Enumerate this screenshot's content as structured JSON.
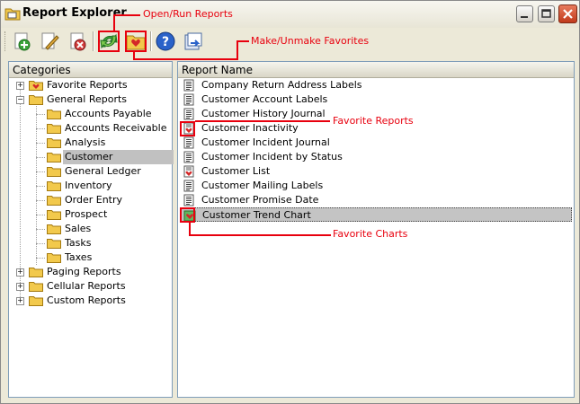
{
  "window": {
    "title": "Report Explorer"
  },
  "toolbar": {
    "buttons": [
      "new-report-icon",
      "edit-report-icon",
      "delete-report-icon",
      "open-run-report-icon",
      "make-favorite-icon",
      "help-icon",
      "export-icon"
    ]
  },
  "categories_panel": {
    "header": "Categories",
    "items": [
      {
        "label": "Favorite Reports",
        "level": 0,
        "expander": "+",
        "favorite": true
      },
      {
        "label": "General Reports",
        "level": 0,
        "expander": "−"
      },
      {
        "label": "Accounts Payable",
        "level": 1
      },
      {
        "label": "Accounts Receivable",
        "level": 1
      },
      {
        "label": "Analysis",
        "level": 1
      },
      {
        "label": "Customer",
        "level": 1,
        "selected": true
      },
      {
        "label": "General Ledger",
        "level": 1
      },
      {
        "label": "Inventory",
        "level": 1
      },
      {
        "label": "Order Entry",
        "level": 1
      },
      {
        "label": "Prospect",
        "level": 1
      },
      {
        "label": "Sales",
        "level": 1
      },
      {
        "label": "Tasks",
        "level": 1
      },
      {
        "label": "Taxes",
        "level": 1
      },
      {
        "label": "Paging Reports",
        "level": 0,
        "expander": "+"
      },
      {
        "label": "Cellular Reports",
        "level": 0,
        "expander": "+"
      },
      {
        "label": "Custom Reports",
        "level": 0,
        "expander": "+"
      }
    ]
  },
  "reports_panel": {
    "header": "Report Name",
    "items": [
      {
        "label": "Company Return Address Labels",
        "icon": "report"
      },
      {
        "label": "Customer Account Labels",
        "icon": "report"
      },
      {
        "label": "Customer History Journal",
        "icon": "report"
      },
      {
        "label": "Customer Inactivity",
        "icon": "favorite-report"
      },
      {
        "label": "Customer Incident Journal",
        "icon": "report"
      },
      {
        "label": "Customer Incident by Status",
        "icon": "report"
      },
      {
        "label": "Customer List",
        "icon": "favorite-report"
      },
      {
        "label": "Customer Mailing Labels",
        "icon": "report"
      },
      {
        "label": "Customer Promise Date",
        "icon": "report"
      },
      {
        "label": "Customer Trend Chart",
        "icon": "favorite-chart",
        "selected": true
      }
    ]
  },
  "annotations": {
    "open_run": "Open/Run Reports",
    "make_favorites": "Make/Unmake Favorites",
    "favorite_reports": "Favorite Reports",
    "favorite_charts": "Favorite Charts"
  },
  "colors": {
    "annotation": "#e8000e",
    "selection": "#c1c1c1",
    "panel_border": "#7f9db9",
    "folder": "#f2c94c"
  }
}
